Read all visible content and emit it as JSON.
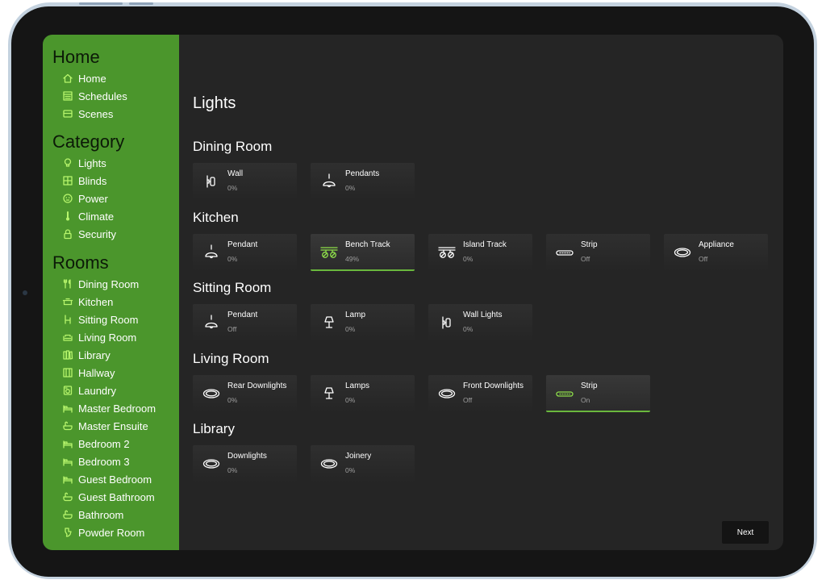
{
  "sidebar": {
    "home_title": "Home",
    "home_items": [
      {
        "label": "Home",
        "icon": "house-icon"
      },
      {
        "label": "Schedules",
        "icon": "calendar-icon"
      },
      {
        "label": "Scenes",
        "icon": "scenes-icon"
      }
    ],
    "category_title": "Category",
    "category_items": [
      {
        "label": "Lights",
        "icon": "bulb-icon"
      },
      {
        "label": "Blinds",
        "icon": "blinds-icon"
      },
      {
        "label": "Power",
        "icon": "power-icon"
      },
      {
        "label": "Climate",
        "icon": "thermometer-icon"
      },
      {
        "label": "Security",
        "icon": "lock-icon"
      }
    ],
    "rooms_title": "Rooms",
    "room_items": [
      {
        "label": "Dining Room",
        "icon": "dining-icon"
      },
      {
        "label": "Kitchen",
        "icon": "pot-icon"
      },
      {
        "label": "Sitting Room",
        "icon": "chair-icon"
      },
      {
        "label": "Living Room",
        "icon": "sofa-icon"
      },
      {
        "label": "Library",
        "icon": "books-icon"
      },
      {
        "label": "Hallway",
        "icon": "hallway-icon"
      },
      {
        "label": "Laundry",
        "icon": "washer-icon"
      },
      {
        "label": "Master Bedroom",
        "icon": "bed-icon"
      },
      {
        "label": "Master Ensuite",
        "icon": "bath-icon"
      },
      {
        "label": "Bedroom 2",
        "icon": "bed-icon"
      },
      {
        "label": "Bedroom 3",
        "icon": "bed-icon"
      },
      {
        "label": "Guest Bedroom",
        "icon": "bed-icon"
      },
      {
        "label": "Guest Bathroom",
        "icon": "bath-icon"
      },
      {
        "label": "Bathroom",
        "icon": "bath-icon"
      },
      {
        "label": "Powder Room",
        "icon": "toilet-icon"
      }
    ]
  },
  "main": {
    "title": "Lights",
    "rooms": [
      {
        "name": "Dining Room",
        "lights": [
          {
            "name": "Wall",
            "status": "0%",
            "icon": "wall-light-icon",
            "active": false
          },
          {
            "name": "Pendants",
            "status": "0%",
            "icon": "pendant-icon",
            "active": false
          }
        ]
      },
      {
        "name": "Kitchen",
        "lights": [
          {
            "name": "Pendant",
            "status": "0%",
            "icon": "pendant-icon",
            "active": false
          },
          {
            "name": "Bench Track",
            "status": "49%",
            "icon": "track-light-icon",
            "active": true
          },
          {
            "name": "Island Track",
            "status": "0%",
            "icon": "track-light-icon",
            "active": false
          },
          {
            "name": "Strip",
            "status": "Off",
            "icon": "strip-light-icon",
            "active": false
          },
          {
            "name": "Appliance",
            "status": "Off",
            "icon": "downlight-icon",
            "active": false
          }
        ]
      },
      {
        "name": "Sitting Room",
        "lights": [
          {
            "name": "Pendant",
            "status": "Off",
            "icon": "pendant-icon",
            "active": false
          },
          {
            "name": "Lamp",
            "status": "0%",
            "icon": "lamp-icon",
            "active": false
          },
          {
            "name": "Wall Lights",
            "status": "0%",
            "icon": "wall-light-icon",
            "active": false
          }
        ]
      },
      {
        "name": "Living Room",
        "lights": [
          {
            "name": "Rear Downlights",
            "status": "0%",
            "icon": "downlight-icon",
            "active": false
          },
          {
            "name": "Lamps",
            "status": "0%",
            "icon": "lamp-icon",
            "active": false
          },
          {
            "name": "Front Downlights",
            "status": "Off",
            "icon": "downlight-icon",
            "active": false
          },
          {
            "name": "Strip",
            "status": "On",
            "icon": "strip-light-icon",
            "active": true
          }
        ]
      },
      {
        "name": "Library",
        "lights": [
          {
            "name": "Downlights",
            "status": "0%",
            "icon": "downlight-icon",
            "active": false
          },
          {
            "name": "Joinery",
            "status": "0%",
            "icon": "downlight-icon",
            "active": false
          }
        ]
      }
    ],
    "next_label": "Next"
  },
  "colors": {
    "sidebar_bg": "#4b962c",
    "accent": "#6ab83d",
    "main_bg": "#252525",
    "nav_icon": "#b7f56c"
  }
}
